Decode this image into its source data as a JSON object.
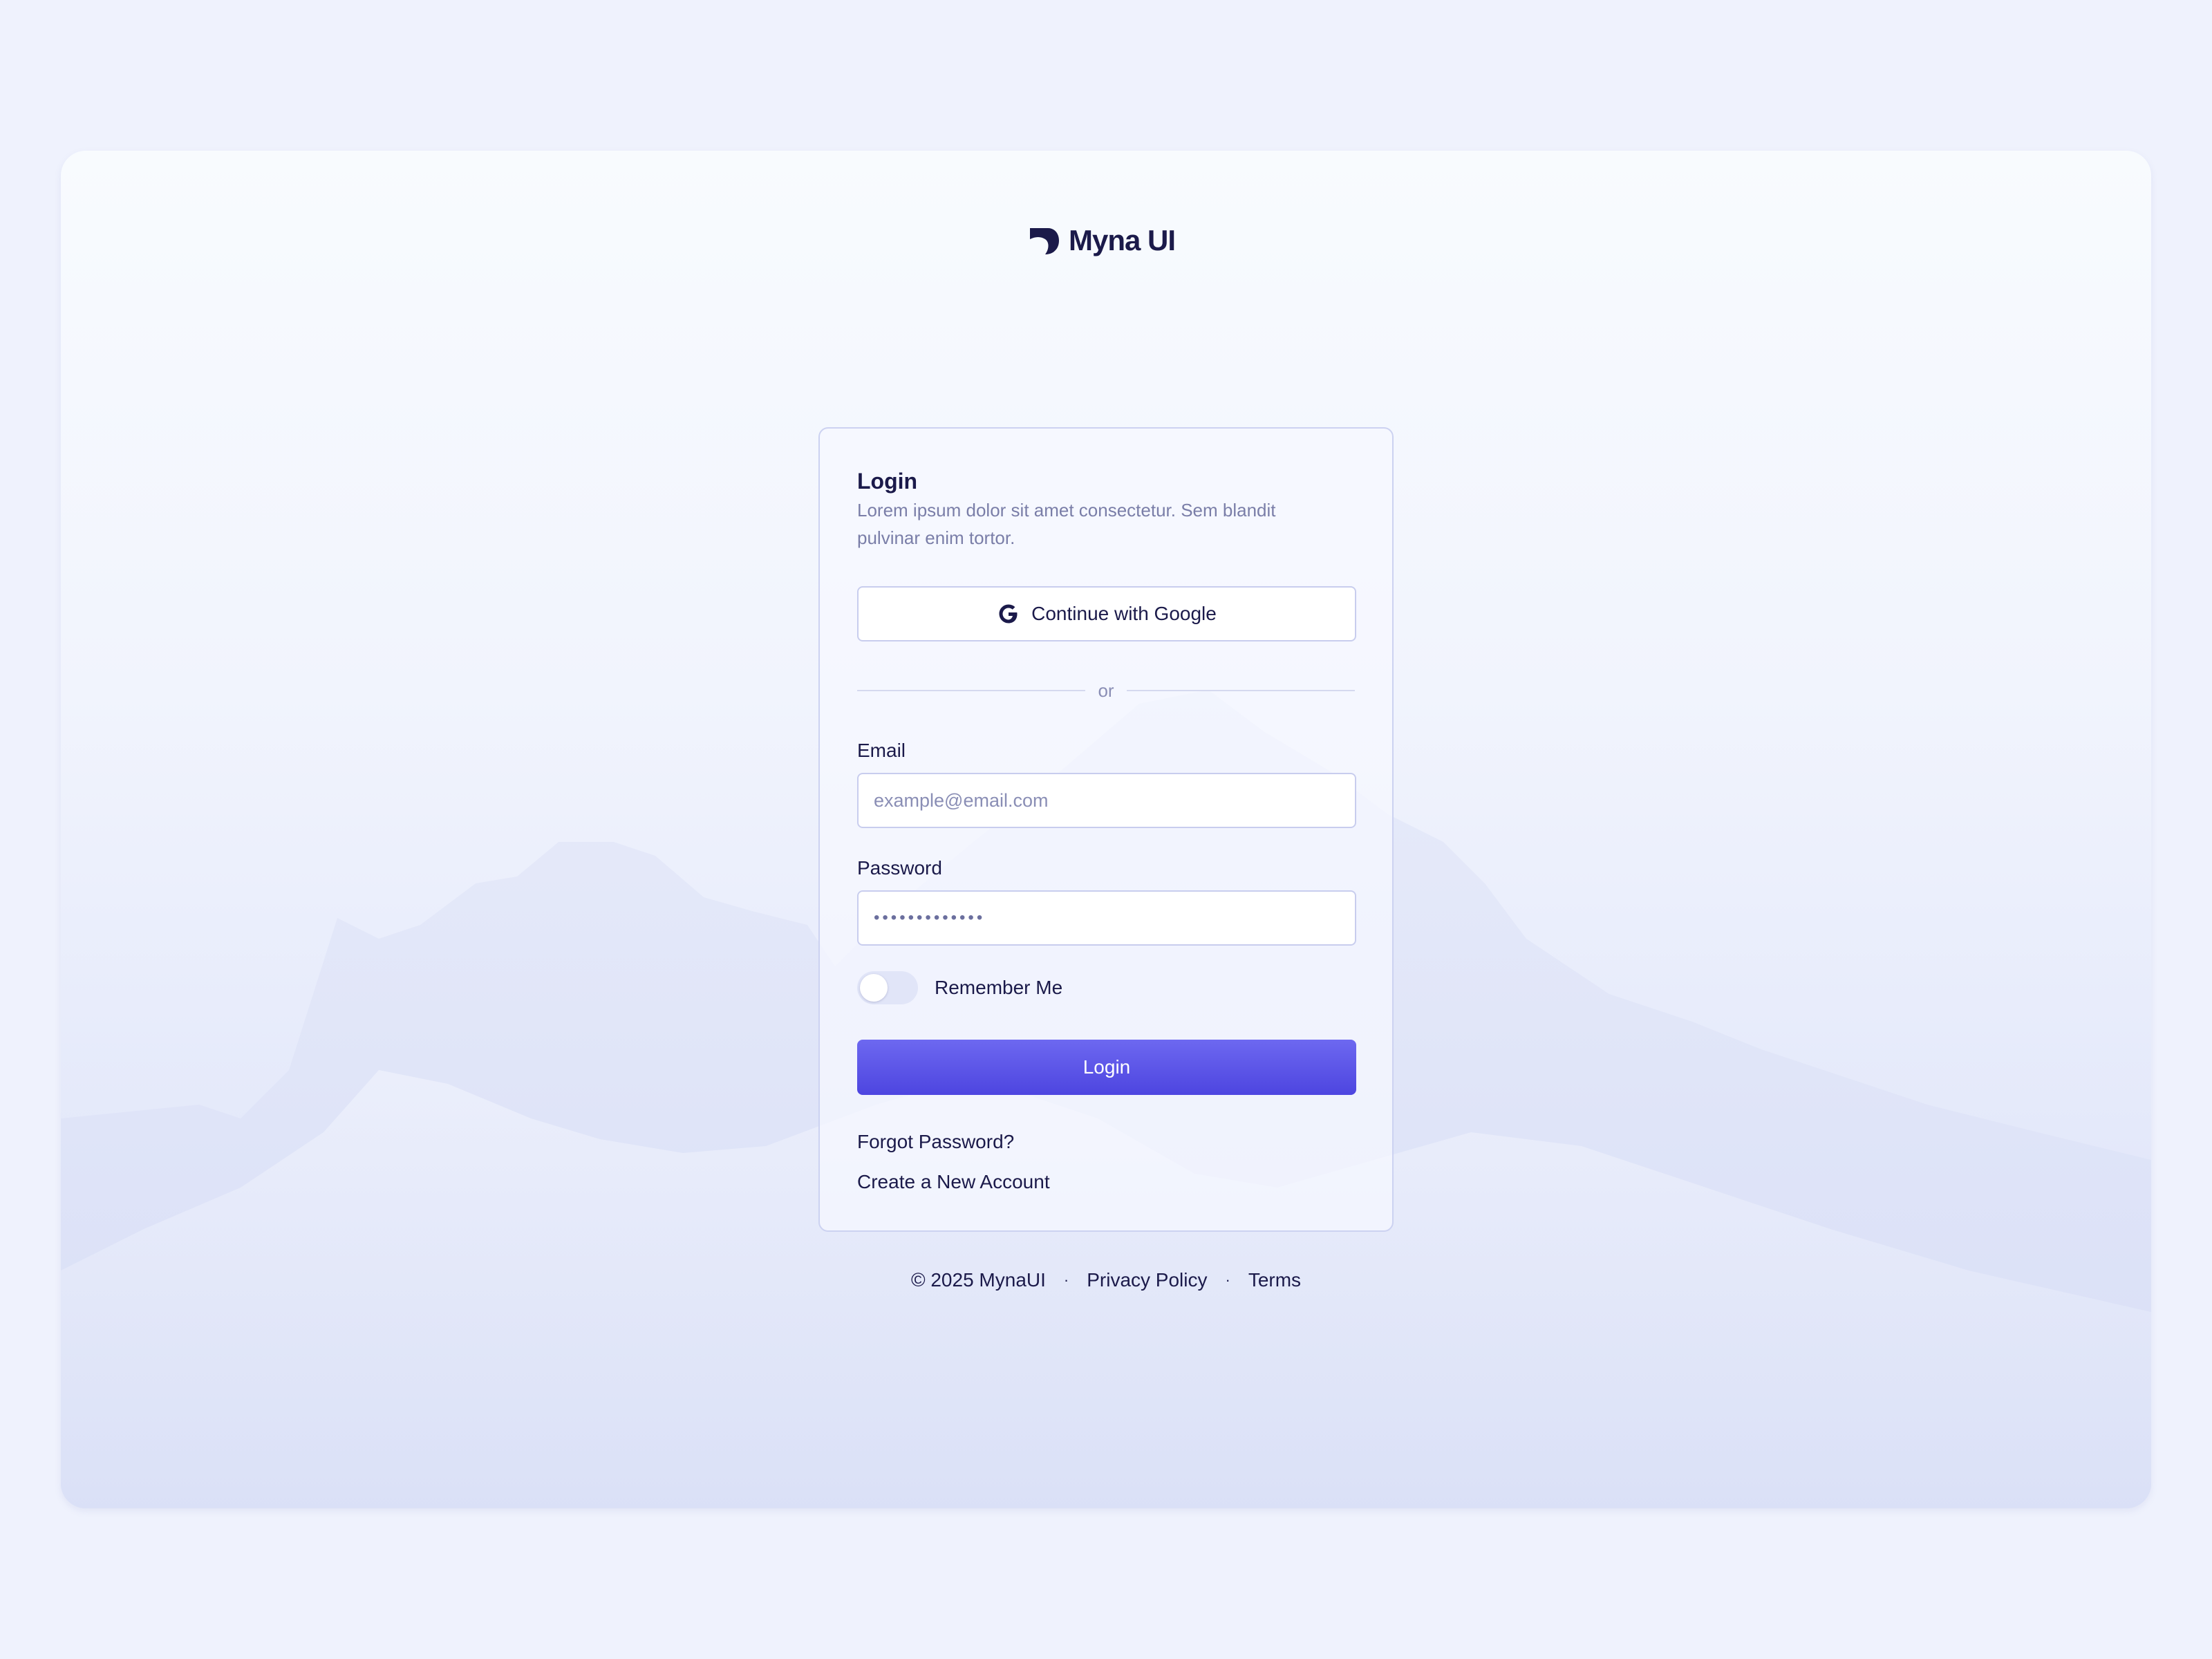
{
  "brand": {
    "name": "Myna UI",
    "logo_icon": "myna-logo-icon",
    "text_color": "#1b1a4a"
  },
  "login": {
    "title": "Login",
    "subtitle": "Lorem ipsum dolor sit amet consectetur. Sem blandit pulvinar enim tortor.",
    "google_button": "Continue with Google",
    "google_icon": "google-g-icon",
    "divider": "or",
    "email": {
      "label": "Email",
      "placeholder": "example@email.com",
      "value": ""
    },
    "password": {
      "label": "Password",
      "value": "•••••••••••••"
    },
    "remember": {
      "label": "Remember Me",
      "checked": false
    },
    "submit": "Login",
    "accent": "#5a54e8",
    "forgot": "Forgot Password?",
    "create": "Create a New Account"
  },
  "footer": {
    "copyright": "© 2025 MynaUI",
    "separator": "·",
    "privacy": "Privacy Policy",
    "terms": "Terms"
  }
}
